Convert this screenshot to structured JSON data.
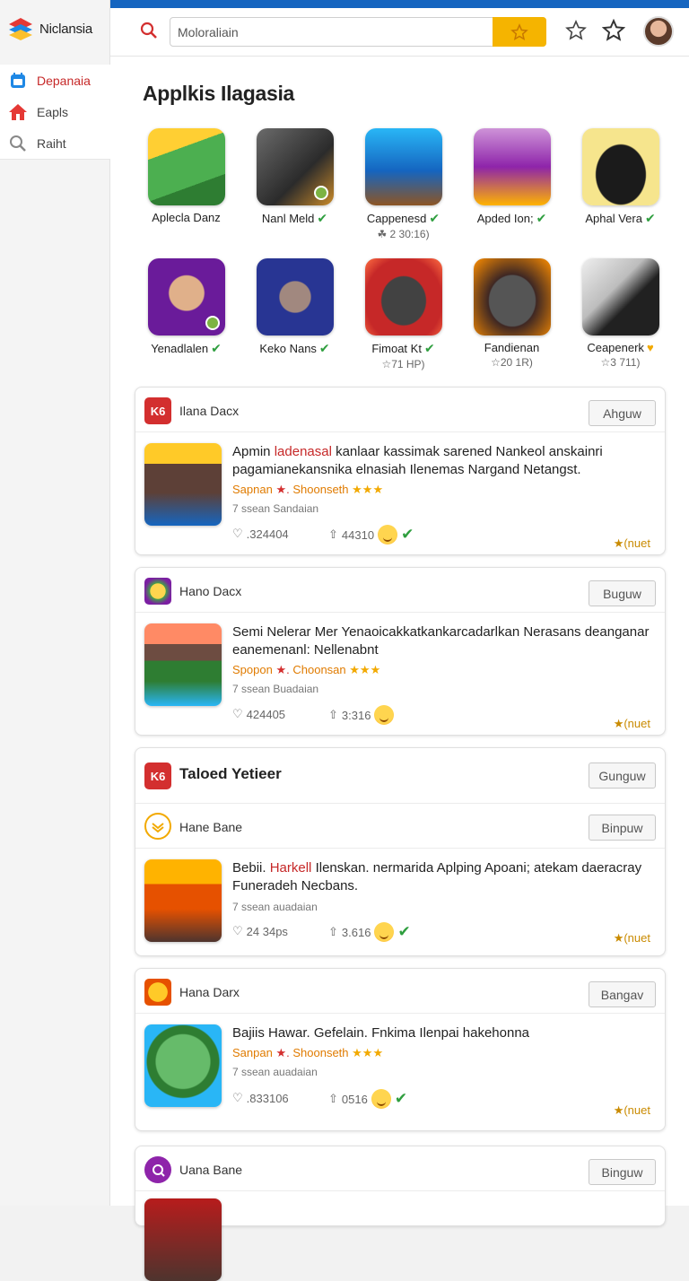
{
  "app": {
    "name": "Niclansia"
  },
  "sidebar": {
    "items": [
      {
        "label": "Depanaia",
        "icon": "calendar-icon",
        "active": true
      },
      {
        "label": "Eapls",
        "icon": "home-icon",
        "active": false
      },
      {
        "label": "Raiht",
        "icon": "search-icon",
        "active": false
      }
    ]
  },
  "header": {
    "search_value": "Moloraliain",
    "accent": "#1565c0",
    "search_button_color": "#f5b400"
  },
  "section": {
    "title": "Applkis Ilagasia",
    "apps": [
      {
        "name": "Aplecla Danz",
        "check": false,
        "sub": ""
      },
      {
        "name": "Nanl Meld",
        "check": true,
        "sub": ""
      },
      {
        "name": "Cappenesd",
        "check": true,
        "sub": "☘ 2 30:16)"
      },
      {
        "name": "Apded Ion;",
        "check": true,
        "sub": ""
      },
      {
        "name": "Aphal Vera",
        "check": true,
        "sub": ""
      },
      {
        "name": "Yenadlalen",
        "check": true,
        "sub": ""
      },
      {
        "name": "Keko Nans",
        "check": true,
        "sub": ""
      },
      {
        "name": "Fimoat Kt",
        "check": true,
        "sub": "☆71 HP)"
      },
      {
        "name": "Fandienan",
        "check": false,
        "sub": "☆20 1R)"
      },
      {
        "name": "Ceapenerk",
        "check": false,
        "sub": "☆3 711)",
        "mark": "♥"
      }
    ]
  },
  "feed": [
    {
      "source": "Ilana Dacx",
      "follow": "Ahguw",
      "headline": [
        "Apmin",
        "ladenasal",
        "kanlaar kassimak sarened Nankeol anskainri pagamianekansnika elnasiah Ilenemas Nargand Netangst."
      ],
      "meta": [
        "Sapnan",
        "Shoonseth",
        "★★★"
      ],
      "age": "7 ssean Sandaian",
      "likes": ".324404",
      "shares": "44310",
      "rating": "★(nuet"
    },
    {
      "source": "Hano Dacx",
      "follow": "Buguw",
      "headline": [
        "Semi",
        "",
        "Nelerar Mer Yenaoicakkatkankarcadarlkan Nerasans deanganar eanemenanl: Nellenabnt"
      ],
      "meta": [
        "Spopon",
        "Choonsan",
        "★★★"
      ],
      "age": "7 ssean Buadaian",
      "likes": "424405",
      "shares": "3:316",
      "rating": "★(nuet"
    },
    {
      "source": "Taloed Yetieer",
      "follow": "Gunguw",
      "sub_source": "Hane Bane",
      "sub_follow": "Binpuw",
      "headline": [
        "Bebii.",
        "Harkell",
        "Ilenskan. nermarida Aplping Apoani; atekam daeracray Funeradeh Necbans."
      ],
      "meta": [],
      "age": "7 ssean auadaian",
      "likes": "24 34ps",
      "shares": "3.616",
      "rating": "★(nuet"
    },
    {
      "source": "Hana Darx",
      "follow": "Bangav",
      "headline": [
        "Bajiis Hawar. Gefelain. Fnkima Ilenpai hakehonna",
        "",
        ""
      ],
      "meta": [
        "Sanpan",
        "Shoonseth",
        "★★★"
      ],
      "age": "7 ssean auadaian",
      "likes": ".833106",
      "shares": "0516",
      "rating": "★(nuet"
    },
    {
      "source": "Uana Bane",
      "follow": "Binguw"
    }
  ]
}
